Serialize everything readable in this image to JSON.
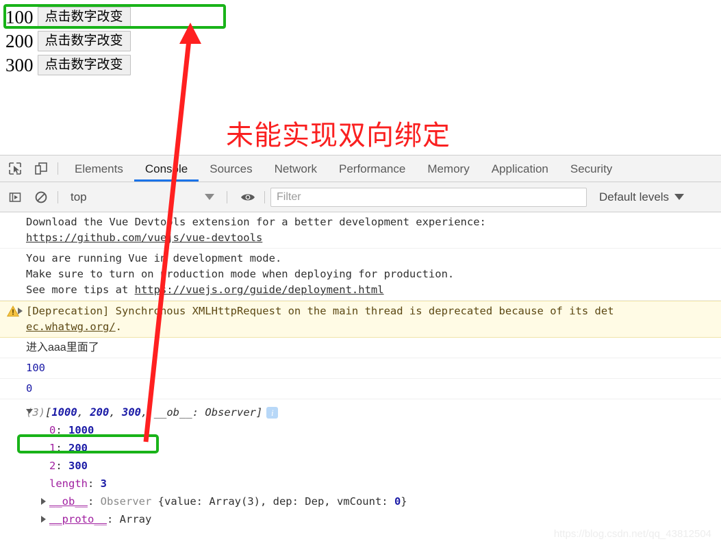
{
  "page": {
    "rows": [
      {
        "value": "100",
        "button_label": "点击数字改变"
      },
      {
        "value": "200",
        "button_label": "点击数字改变"
      },
      {
        "value": "300",
        "button_label": "点击数字改变"
      }
    ],
    "annotation": "未能实现双向绑定"
  },
  "devtools": {
    "icons": {
      "inspect": "inspect-cursor-icon",
      "device": "device-toolbar-icon"
    },
    "tabs": [
      {
        "label": "Elements",
        "active": false
      },
      {
        "label": "Console",
        "active": true
      },
      {
        "label": "Sources",
        "active": false
      },
      {
        "label": "Network",
        "active": false
      },
      {
        "label": "Performance",
        "active": false
      },
      {
        "label": "Memory",
        "active": false
      },
      {
        "label": "Application",
        "active": false
      },
      {
        "label": "Security",
        "active": false
      }
    ],
    "filterbar": {
      "sidebar_toggle_icon": "show-console-sidebar-icon",
      "clear_icon": "clear-console-icon",
      "context": "top",
      "eye_icon": "live-expression-eye-icon",
      "filter_placeholder": "Filter",
      "filter_value": "",
      "levels": "Default levels"
    },
    "accent_color": "#1a73e8",
    "highlight_color": "#19b319",
    "annotation_color": "#fa2020"
  },
  "console": {
    "messages": [
      {
        "kind": "log",
        "line1": "Download the Vue Devtools extension for a better development experience:",
        "link": "https://github.com/vuejs/vue-devtools"
      },
      {
        "kind": "log",
        "line1": "You are running Vue in development mode.",
        "line2": "Make sure to turn on production mode when deploying for production.",
        "line3_prefix": "See more tips at ",
        "line3_link": "https://vuejs.org/guide/deployment.html"
      },
      {
        "kind": "warning",
        "icon": "warning-triangle-icon",
        "line1": "[Deprecation] Synchronous XMLHttpRequest on the main thread is deprecated because of its det",
        "line2_link": "ec.whatwg.org/",
        "line2_suffix": "."
      },
      {
        "kind": "log",
        "text": "进入aaa里面了"
      },
      {
        "kind": "log",
        "text": "100",
        "value_type": "number"
      },
      {
        "kind": "log",
        "text": "0",
        "value_type": "number"
      }
    ],
    "array_preview": {
      "count": "(3)",
      "prefix": "[",
      "items": [
        "1000",
        "200",
        "300"
      ],
      "observer_key": "__ob__",
      "observer_val": "Observer",
      "suffix": "]",
      "info_glyph": "i"
    },
    "array_props": [
      {
        "key": "0",
        "value": "1000",
        "type": "number",
        "highlighted": true
      },
      {
        "key": "1",
        "value": "200",
        "type": "number",
        "highlighted": false
      },
      {
        "key": "2",
        "value": "300",
        "type": "number",
        "highlighted": false
      },
      {
        "key": "length",
        "value": "3",
        "type": "number",
        "highlighted": false
      }
    ],
    "ob_row": {
      "key": "__ob__",
      "class_name": "Observer",
      "body_open": "{value: Array(3), dep: Dep, vmCount: ",
      "vm_count": "0",
      "body_close": "}"
    },
    "proto_row": {
      "key": "__proto__",
      "value": "Array"
    }
  },
  "watermark": "https://blog.csdn.net/qq_43812504"
}
